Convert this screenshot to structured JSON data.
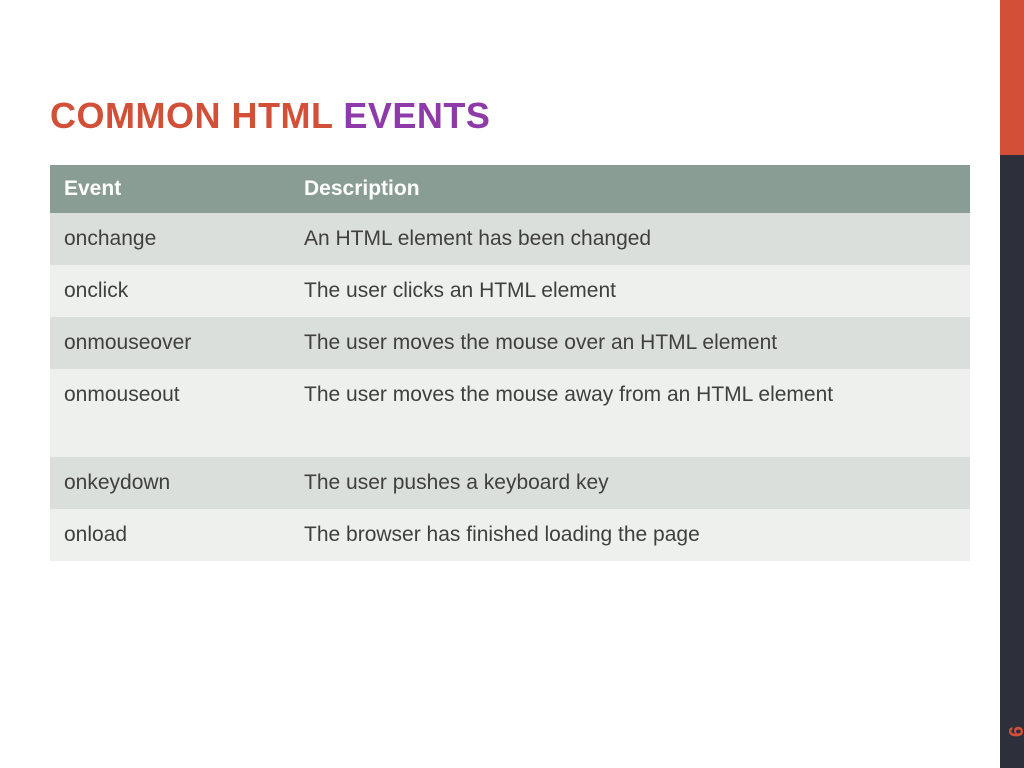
{
  "title": {
    "part1": "COMMON HTML",
    "part2": "EVENTS"
  },
  "headers": {
    "event": "Event",
    "description": "Description"
  },
  "rows": [
    {
      "event": "onchange",
      "description": "An HTML element has been changed"
    },
    {
      "event": "onclick",
      "description": "The user clicks an HTML element"
    },
    {
      "event": "onmouseover",
      "description": "The user moves the mouse over an HTML element"
    },
    {
      "event": "onmouseout",
      "description": "The user moves the mouse away from an HTML element"
    },
    {
      "event": "onkeydown",
      "description": "The user pushes a keyboard key"
    },
    {
      "event": "onload",
      "description": "The browser has finished loading the page"
    }
  ],
  "pageNumber": "9"
}
